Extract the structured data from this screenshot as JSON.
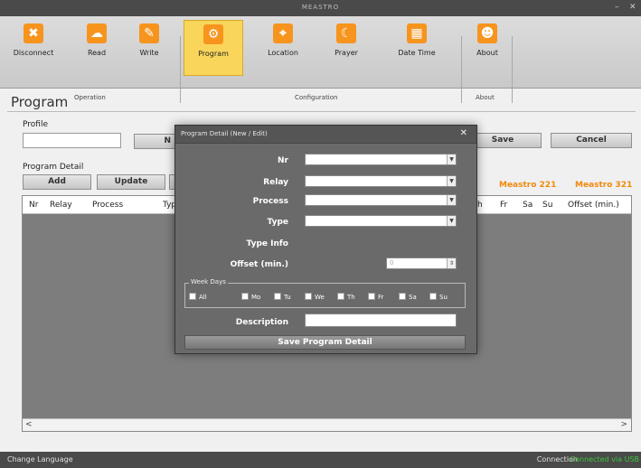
{
  "window": {
    "title": "MEASTRO",
    "min": "–",
    "close": "✕"
  },
  "ribbon": {
    "buttons": [
      {
        "label": "Disconnect",
        "icon": "disconnect-icon",
        "glyph": "✖"
      },
      {
        "label": "Read",
        "icon": "read-icon",
        "glyph": "☁"
      },
      {
        "label": "Write",
        "icon": "write-icon",
        "glyph": "✎"
      },
      {
        "label": "Program",
        "icon": "program-icon",
        "glyph": "⚙"
      },
      {
        "label": "Location",
        "icon": "location-icon",
        "glyph": "⌖"
      },
      {
        "label": "Prayer",
        "icon": "prayer-icon",
        "glyph": "☾"
      },
      {
        "label": "Date Time",
        "icon": "calendar-icon",
        "glyph": "▦"
      },
      {
        "label": "About",
        "icon": "about-icon",
        "glyph": "☻"
      }
    ],
    "groups": [
      "Operation",
      "Configuration",
      "About"
    ]
  },
  "page": {
    "title": "Program"
  },
  "profile": {
    "label": "Profile",
    "value": "",
    "hidden_button_partial": "N"
  },
  "actions": {
    "save": "Save",
    "cancel": "Cancel"
  },
  "program_detail": {
    "label": "Program Detail",
    "add": "Add",
    "update": "Update",
    "meastro221": "Meastro 221",
    "meastro321": "Meastro 321"
  },
  "table": {
    "columns_left": [
      "Nr",
      "Relay",
      "Process",
      "Typ"
    ],
    "columns_right": [
      "h",
      "Fr",
      "Sa",
      "Su",
      "Offset (min.)"
    ]
  },
  "modal": {
    "title": "Program Detail (New / Edit)",
    "close": "✕",
    "nr_label": "Nr",
    "relay_label": "Relay",
    "process_label": "Process",
    "type_label": "Type",
    "type_info_label": "Type Info",
    "offset_label": "Offset (min.)",
    "offset_value": "0",
    "weekdays_legend": "Week Days",
    "days": [
      "All",
      "Mo",
      "Tu",
      "We",
      "Th",
      "Fr",
      "Sa",
      "Su"
    ],
    "description_label": "Description",
    "description_value": "",
    "save_button": "Save Program Detail"
  },
  "status": {
    "change_language": "Change Language",
    "connection_label": "Connection",
    "connection_value": "Connected via USB",
    "connection_color": "#3ec43e"
  },
  "colors": {
    "accent_orange": "#f7941d",
    "active_tab": "#f9d65a",
    "meastro_label": "#f08a0c"
  }
}
